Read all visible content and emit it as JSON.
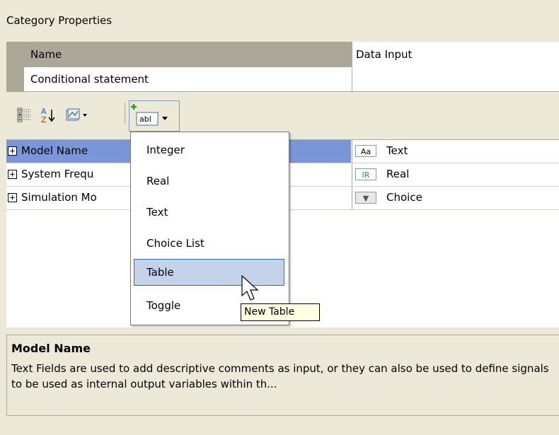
{
  "panel": {
    "title": "Category Properties"
  },
  "name_table": {
    "header_key": "Name",
    "header_value": "Data Input",
    "row_key": "Conditional statement"
  },
  "toolbar": {
    "categorized_icon": "categorized-icon",
    "sort_icon": "sort-az-icon",
    "pages_icon": "property-pages-icon",
    "add_icon": "add-field-icon",
    "add_icon_text": "abl"
  },
  "properties": [
    {
      "label": "Model Name",
      "expander": "+",
      "icon_text": "Aa",
      "value": "Text",
      "selected": true
    },
    {
      "label": "System Frequ",
      "expander": "+",
      "icon_text": "IR",
      "value": "Real",
      "selected": false
    },
    {
      "label": "Simulation Mo",
      "expander": "+",
      "icon_text": "▼",
      "value": "Choice",
      "selected": false
    }
  ],
  "menu": {
    "items": [
      {
        "label": "Integer",
        "highlighted": false
      },
      {
        "label": "Real",
        "highlighted": false
      },
      {
        "label": "Text",
        "highlighted": false
      },
      {
        "label": "Choice List",
        "highlighted": false
      },
      {
        "label": "Table",
        "highlighted": true
      },
      {
        "label": "Toggle",
        "highlighted": false
      }
    ]
  },
  "tooltip": {
    "text": "New Table"
  },
  "description": {
    "title": "Model Name",
    "text": "Text Fields are used to add descriptive comments as input, or they can also be used to define signals to be used as internal output variables within th..."
  },
  "colors": {
    "selection": "#7b96d8",
    "menu_highlight": "#c4d2ea",
    "tooltip_bg": "#ffffe1",
    "panel_bg": "#ece9d8"
  }
}
